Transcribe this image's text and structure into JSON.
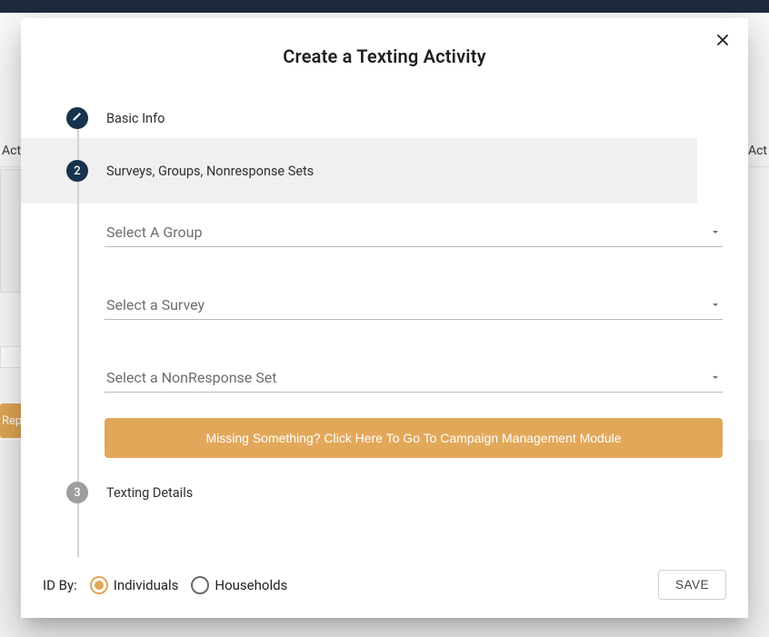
{
  "background": {
    "left_tab": "Activ",
    "right_tab": "Act",
    "report_chip": "Repo"
  },
  "dialog": {
    "title": "Create a Texting Activity",
    "close_name": "close"
  },
  "steps": {
    "basic_info": {
      "label": "Basic Info"
    },
    "surveys": {
      "index": "2",
      "label": "Surveys, Groups, Nonresponse Sets"
    },
    "details": {
      "index": "3",
      "label": "Texting Details"
    }
  },
  "selects": {
    "group_placeholder": "Select A Group",
    "survey_placeholder": "Select a Survey",
    "nonresponse_placeholder": "Select a NonResponse Set"
  },
  "banner": {
    "label": "Missing Something? Click Here To Go To Campaign Management Module"
  },
  "footer": {
    "id_by_label": "ID By:",
    "individuals_label": "Individuals",
    "households_label": "Households",
    "save_label": "SAVE"
  }
}
